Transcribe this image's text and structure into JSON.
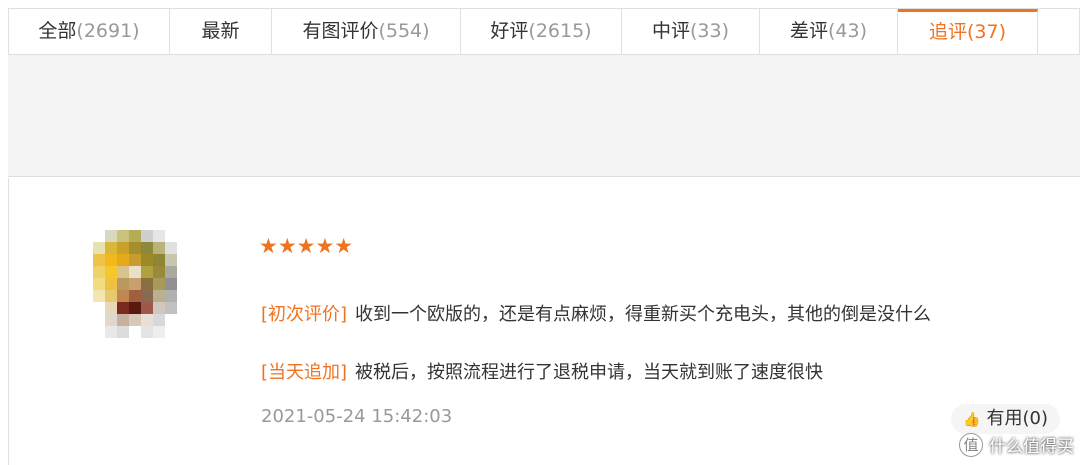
{
  "tabs": [
    {
      "label": "全部",
      "count": "(2691)"
    },
    {
      "label": "最新",
      "count": ""
    },
    {
      "label": "有图评价",
      "count": "(554)"
    },
    {
      "label": "好评",
      "count": "(2615)"
    },
    {
      "label": "中评",
      "count": "(33)"
    },
    {
      "label": "差评",
      "count": "(43)"
    },
    {
      "label": "追评",
      "count": "(37)"
    }
  ],
  "active_tab": "追评",
  "review": {
    "rating": 5,
    "stars": "★★★★★",
    "initial_tag": "[初次评价]",
    "initial_text": "收到一个欧版的，还是有点麻烦，得重新买个充电头，其他的倒是没什么",
    "followup_tag": "[当天追加]",
    "followup_text": "被税后，按照流程进行了退税申请，当天就到账了速度很快",
    "date": "2021-05-24 15:42:03",
    "useful_label": "有用(0)"
  },
  "watermark": {
    "logo": "值",
    "text": "什么值得买"
  },
  "colors": {
    "accent": "#f0731f",
    "muted": "#999999",
    "filter_bg": "#f3f3f3"
  }
}
